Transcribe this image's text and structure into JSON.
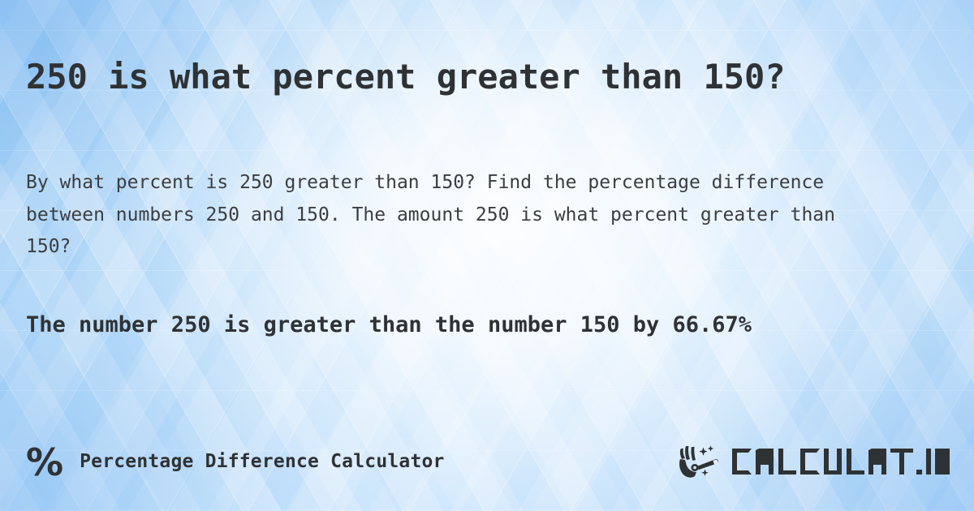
{
  "page": {
    "title": "250 is what percent greater than 150?",
    "description": "By what percent is 250 greater than 150? Find the percentage difference between numbers 250 and 150. The amount 250 is what percent greater than 150?",
    "answer": "The number 250 is greater than the number 150 by 66.67%"
  },
  "values": {
    "number_a": "250",
    "number_b": "150",
    "result_percent": "66.67%"
  },
  "footer": {
    "percent_symbol": "%",
    "label": "Percentage Difference Calculator",
    "brand_name": "CALCULAT.IO"
  },
  "colors": {
    "text_dark": "#2f3234",
    "text_body": "#3b3e41",
    "background_blue": "#a9d2f7",
    "background_highlight": "#ffffff"
  }
}
